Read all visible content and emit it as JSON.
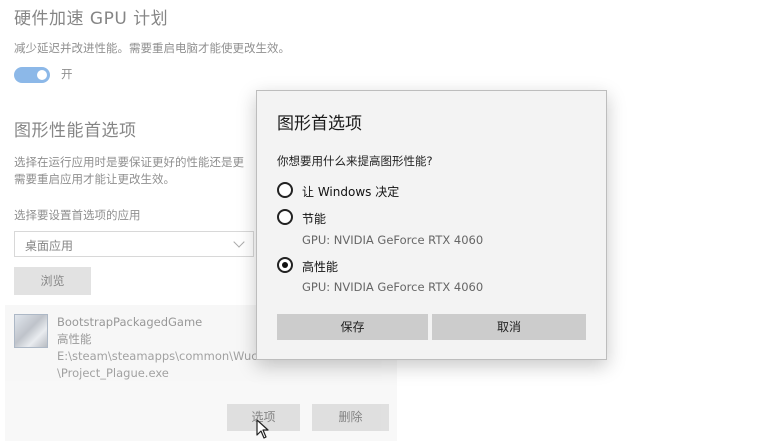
{
  "settings": {
    "hw_accel_title": "硬件加速 GPU 计划",
    "hw_accel_desc": "减少延迟并改进性能。需要重启电脑才能使更改生效。",
    "toggle_state": "开",
    "graphics_pref_title": "图形性能首选项",
    "graphics_pref_desc_line1": "选择在运行应用时是要保证更好的性能还是更",
    "graphics_pref_desc_line2": "需要重启应用才能让更改生效。",
    "choose_app_label": "选择要设置首选项的应用",
    "app_type_selected": "桌面应用",
    "browse_label": "浏览",
    "app": {
      "name": "BootstrapPackagedGame",
      "preference": "高性能",
      "path_line1": "E:\\steam\\steamapps\\common\\Wucha",
      "path_line2": "\\Project_Plague.exe"
    },
    "options_label": "选项",
    "delete_label": "删除"
  },
  "dialog": {
    "title": "图形首选项",
    "question": "你想要用什么来提高图形性能?",
    "options": [
      {
        "label": "让 Windows 决定",
        "sub": "",
        "selected": false
      },
      {
        "label": "节能",
        "sub": "GPU: NVIDIA GeForce RTX 4060",
        "selected": false
      },
      {
        "label": "高性能",
        "sub": "GPU: NVIDIA GeForce RTX 4060",
        "selected": true
      }
    ],
    "save_label": "保存",
    "cancel_label": "取消"
  },
  "colors": {
    "accent": "#2f7fd6",
    "button_grey": "#cccccc",
    "dialog_bg": "#f3f3f3"
  }
}
